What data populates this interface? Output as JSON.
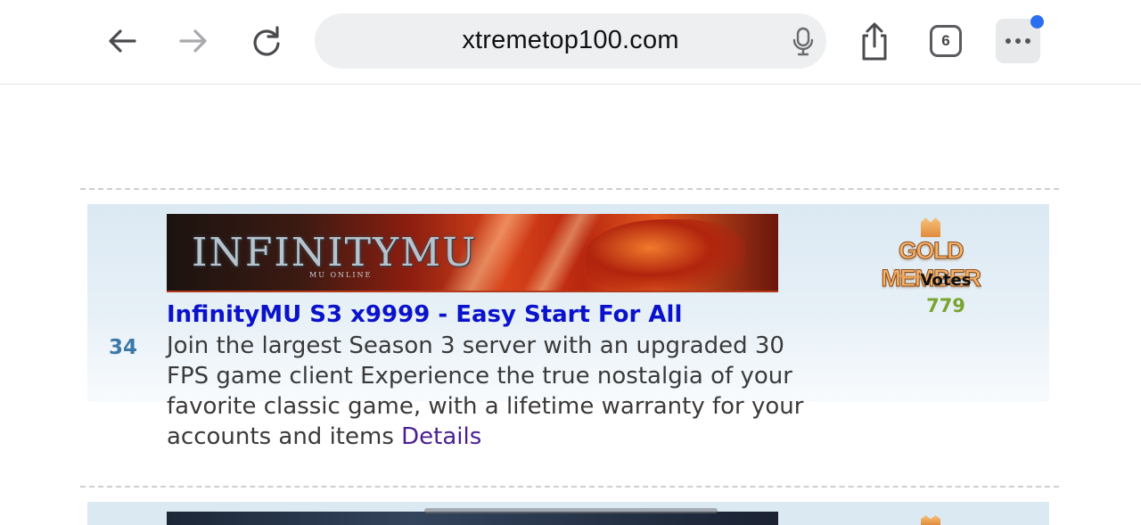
{
  "browser": {
    "url": "xtremetop100.com",
    "tab_count": "6",
    "icons": [
      "back-arrow-icon",
      "forward-arrow-icon",
      "reload-icon",
      "microphone-icon",
      "share-icon",
      "tabs-icon",
      "more-icon"
    ],
    "notification_dot_color": "#2a6ff0"
  },
  "listing": {
    "rank": "34",
    "banner": {
      "logo_text": "INFINITYMU",
      "sub_text": "MU ONLINE"
    },
    "title": "InfinityMU S3 x9999 - Easy Start For All",
    "description": "Join the largest Season 3 server with an upgraded 30 FPS game client Experience the true nostalgia of your favorite classic game, with a lifetime warranty for your accounts and items",
    "details_link": "Details",
    "badge_text": "GOLD MEMBER",
    "votes_label": "Votes",
    "votes": "779",
    "colors": {
      "title": "#0a12cc",
      "rank": "#3d79a8",
      "votes": "#7aa42f",
      "details": "#4b1f92"
    }
  }
}
